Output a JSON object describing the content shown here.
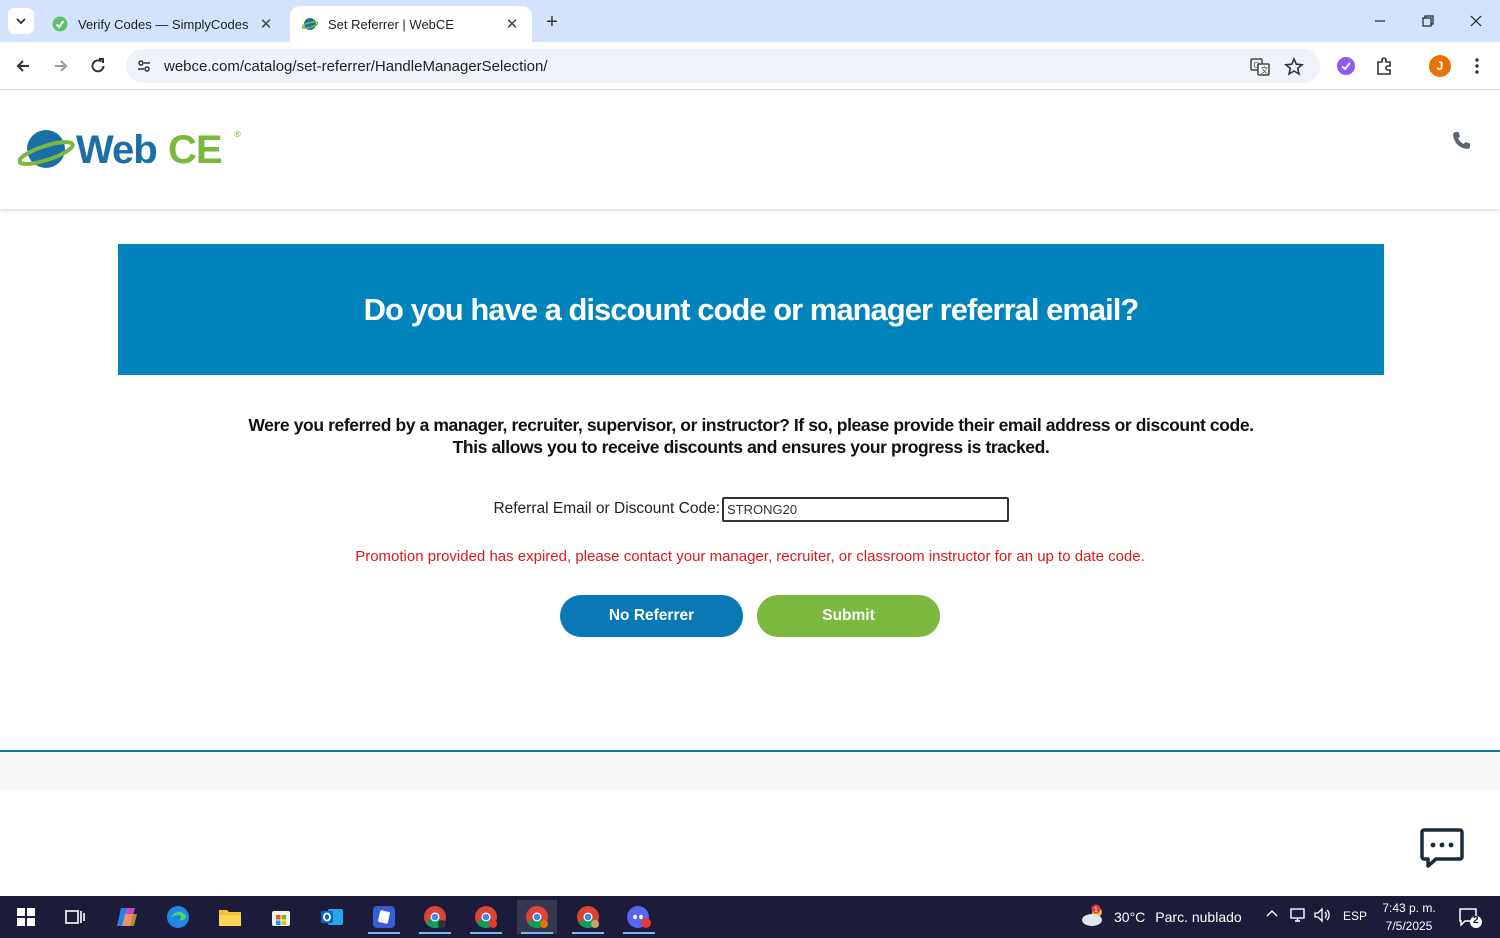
{
  "browser": {
    "tabs": [
      {
        "title": "Verify Codes — SimplyCodes",
        "active": false
      },
      {
        "title": "Set Referrer | WebCE",
        "active": true
      }
    ],
    "url": "webce.com/catalog/set-referrer/HandleManagerSelection/",
    "profile_initial": "J"
  },
  "site": {
    "logo_text": "WebCE",
    "logo_mark": "®",
    "colors": {
      "primary_blue": "#0084bb",
      "button_blue": "#0a78b4",
      "button_green": "#7ab93d",
      "error_red": "#d91b1b"
    }
  },
  "main": {
    "heading": "Do you have a discount code or manager referral email?",
    "intro_line1": "Were you referred by a manager, recruiter, supervisor, or instructor? If so, please provide their email address or discount code.",
    "intro_line2": "This allows you to receive discounts and ensures your progress is tracked.",
    "field_label": "Referral Email or Discount Code:",
    "field_value": "STRONG20",
    "error_message": "Promotion provided has expired, please contact your manager, recruiter, or classroom instructor for an up to date code.",
    "no_referrer_label": "No Referrer",
    "submit_label": "Submit"
  },
  "taskbar": {
    "weather_temp": "30°C",
    "weather_desc": "Parc. nublado",
    "weather_badge": "1",
    "language": "ESP",
    "time": "7:43 p. m.",
    "date": "7/5/2025",
    "notification_count": "2"
  }
}
